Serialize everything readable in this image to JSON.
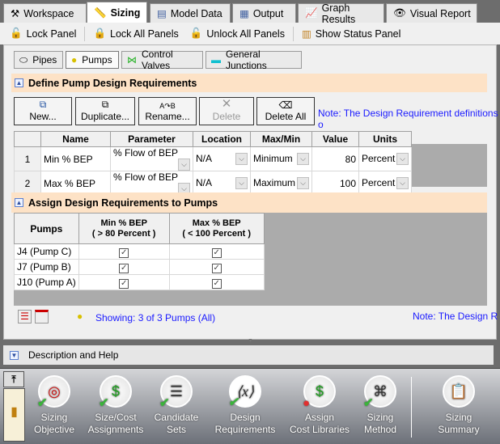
{
  "tabs": [
    {
      "label": "Workspace",
      "icon": "hammer-icon"
    },
    {
      "label": "Sizing",
      "icon": "ruler-icon",
      "active": true
    },
    {
      "label": "Model Data",
      "icon": "notebook-icon"
    },
    {
      "label": "Output",
      "icon": "table-icon"
    },
    {
      "label": "Graph Results",
      "icon": "graph-icon"
    },
    {
      "label": "Visual Report",
      "icon": "eye-icon"
    }
  ],
  "toolbar": {
    "lock_panel": "Lock Panel",
    "lock_all": "Lock All Panels",
    "unlock_all": "Unlock All Panels",
    "show_status": "Show Status Panel"
  },
  "subtabs": [
    {
      "label": "Pipes"
    },
    {
      "label": "Pumps",
      "active": true
    },
    {
      "label": "Control Valves"
    },
    {
      "label": "General Junctions"
    }
  ],
  "define": {
    "title": "Define Pump Design Requirements",
    "buttons": {
      "new": "New...",
      "duplicate": "Duplicate...",
      "rename": "Rename...",
      "delete": "Delete",
      "delete_all": "Delete All"
    },
    "note": "Note: The Design Requirement definitions o",
    "columns": [
      "",
      "Name",
      "Parameter",
      "Location",
      "Max/Min",
      "Value",
      "Units"
    ],
    "rows": [
      {
        "num": "1",
        "name": "Min % BEP",
        "parameter": "% Flow of BEP",
        "location": "N/A",
        "maxmin": "Minimum",
        "value": "80",
        "units": "Percent"
      },
      {
        "num": "2",
        "name": "Max % BEP",
        "parameter": "% Flow of BEP",
        "location": "N/A",
        "maxmin": "Maximum",
        "value": "100",
        "units": "Percent"
      }
    ]
  },
  "assign": {
    "title": "Assign Design Requirements to Pumps",
    "col_pumps": "Pumps",
    "col_min": [
      "Min % BEP",
      "( > 80 Percent )"
    ],
    "col_max": [
      "Max % BEP",
      "( < 100 Percent )"
    ],
    "rows": [
      {
        "pump": "J4 (Pump C)",
        "min": true,
        "max": true
      },
      {
        "pump": "J7 (Pump B)",
        "min": true,
        "max": true
      },
      {
        "pump": "J10 (Pump A)",
        "min": true,
        "max": true
      }
    ],
    "showing": "Showing: 3 of 3 Pumps (All)",
    "note": "Note: The Design R"
  },
  "description": "Description and Help",
  "ribbon": [
    {
      "label": [
        "Sizing",
        "Objective"
      ],
      "icon": "target-icon",
      "status": "check"
    },
    {
      "label": [
        "Size/Cost",
        "Assignments"
      ],
      "icon": "ruler-dollar-icon",
      "status": "check"
    },
    {
      "label": [
        "Candidate",
        "Sets"
      ],
      "icon": "list-icon",
      "status": "check"
    },
    {
      "label": [
        "Design",
        "Requirements"
      ],
      "icon": "function-icon",
      "status": "check"
    },
    {
      "label": [
        "Assign",
        "Cost Libraries"
      ],
      "icon": "coins-dollar-icon",
      "status": "error"
    },
    {
      "label": [
        "Sizing",
        "Method"
      ],
      "icon": "flowchart-icon",
      "status": "check"
    },
    {
      "label": [
        "Sizing",
        "Summary"
      ],
      "icon": "clipboard-icon",
      "status": "none"
    }
  ]
}
